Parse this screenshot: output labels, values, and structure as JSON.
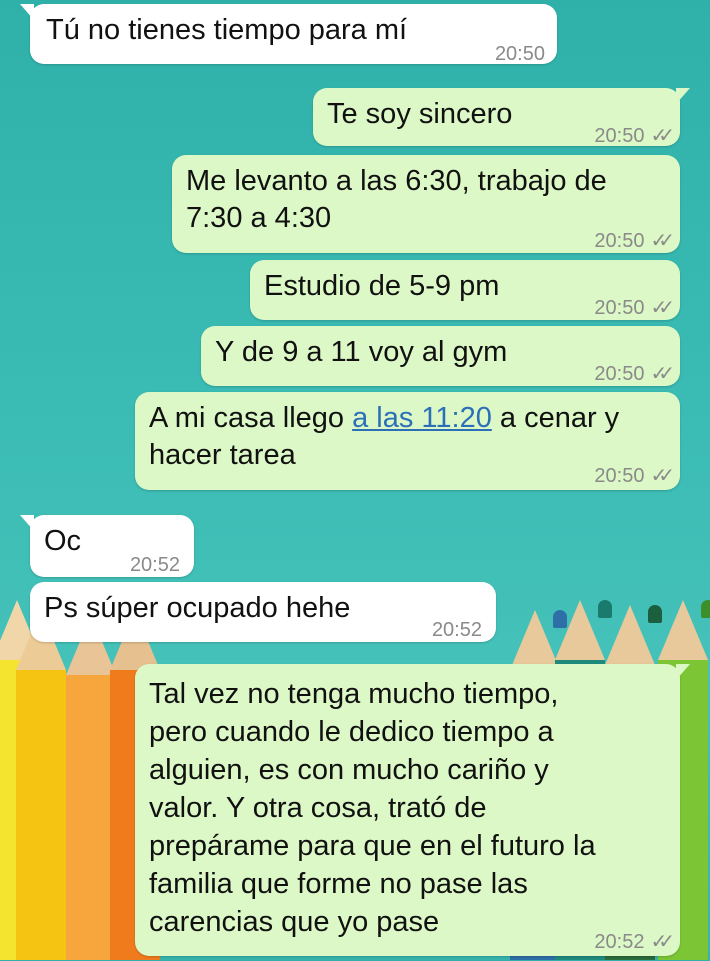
{
  "messages": [
    {
      "direction": "incoming",
      "text": "Tú no tienes tiempo para mí",
      "time": "20:50"
    },
    {
      "direction": "outgoing",
      "text": "Te soy sincero",
      "time": "20:50",
      "status": "read"
    },
    {
      "direction": "outgoing",
      "line1": "Me levanto a las 6:30, trabajo de",
      "line2": "7:30 a 4:30",
      "time": "20:50",
      "status": "read"
    },
    {
      "direction": "outgoing",
      "text": "Estudio de 5-9 pm",
      "time": "20:50",
      "status": "read"
    },
    {
      "direction": "outgoing",
      "text": "Y de 9 a 11 voy al gym",
      "time": "20:50",
      "status": "read"
    },
    {
      "direction": "outgoing",
      "prefix": "A mi casa llego ",
      "link": "a las 11:20",
      "suffix": " a cenar y",
      "line2": "hacer tarea",
      "time": "20:50",
      "status": "read"
    },
    {
      "direction": "incoming",
      "text": "Oc",
      "time": "20:52"
    },
    {
      "direction": "incoming",
      "text": "Ps súper ocupado hehe",
      "time": "20:52"
    },
    {
      "direction": "outgoing",
      "lines": [
        "Tal vez no tenga mucho tiempo,",
        "pero cuando le dedico tiempo a",
        "alguien, es con mucho cariño y",
        "valor. Y otra cosa, trató de",
        "prepárame para que en el futuro la",
        "familia que forme no pase las",
        "carencias que yo pase"
      ],
      "time": "20:52",
      "status": "read"
    }
  ],
  "colors": {
    "background": "#3bbcb4",
    "incoming_bubble": "#ffffff",
    "outgoing_bubble": "#dcf8c6",
    "timestamp": "#8a8a8a",
    "link": "#2b6fb8"
  },
  "icons": {
    "read_receipt": "double-check-icon"
  },
  "status_glyph": "✓✓"
}
